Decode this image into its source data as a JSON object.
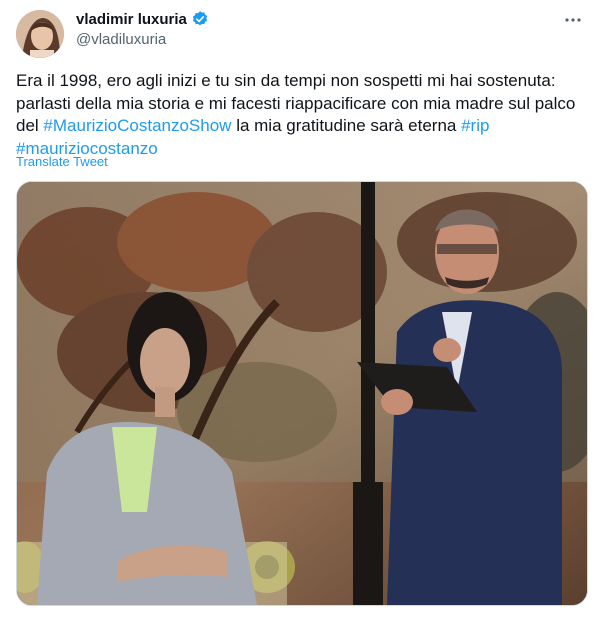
{
  "author": {
    "display_name": "vladimir luxuria",
    "handle": "@vladiluxuria",
    "avatar_icon": "profile-photo",
    "verified_icon": "verified-badge-icon"
  },
  "tweet": {
    "segments": [
      {
        "text": "Era il 1998, ero agli inizi e tu sin da tempi non sospetti mi hai sostenuta: parlasti della mia storia e mi facesti riappacificare con mia madre sul palco del ",
        "link": false
      },
      {
        "text": "#MaurizioCostanzoShow",
        "link": true
      },
      {
        "text": " la mia gratitudine sarà eterna ",
        "link": false
      },
      {
        "text": "#rip",
        "link": true
      },
      {
        "text": " ",
        "link": false
      },
      {
        "text": "#mauriziocostanzo",
        "link": true
      }
    ],
    "translate_label": "Translate Tweet"
  },
  "media": {
    "description_icon": "video-still-image"
  },
  "colors": {
    "link": "#1d9bf0",
    "secondary_text": "#536471",
    "verified": "#1d9bf0"
  }
}
